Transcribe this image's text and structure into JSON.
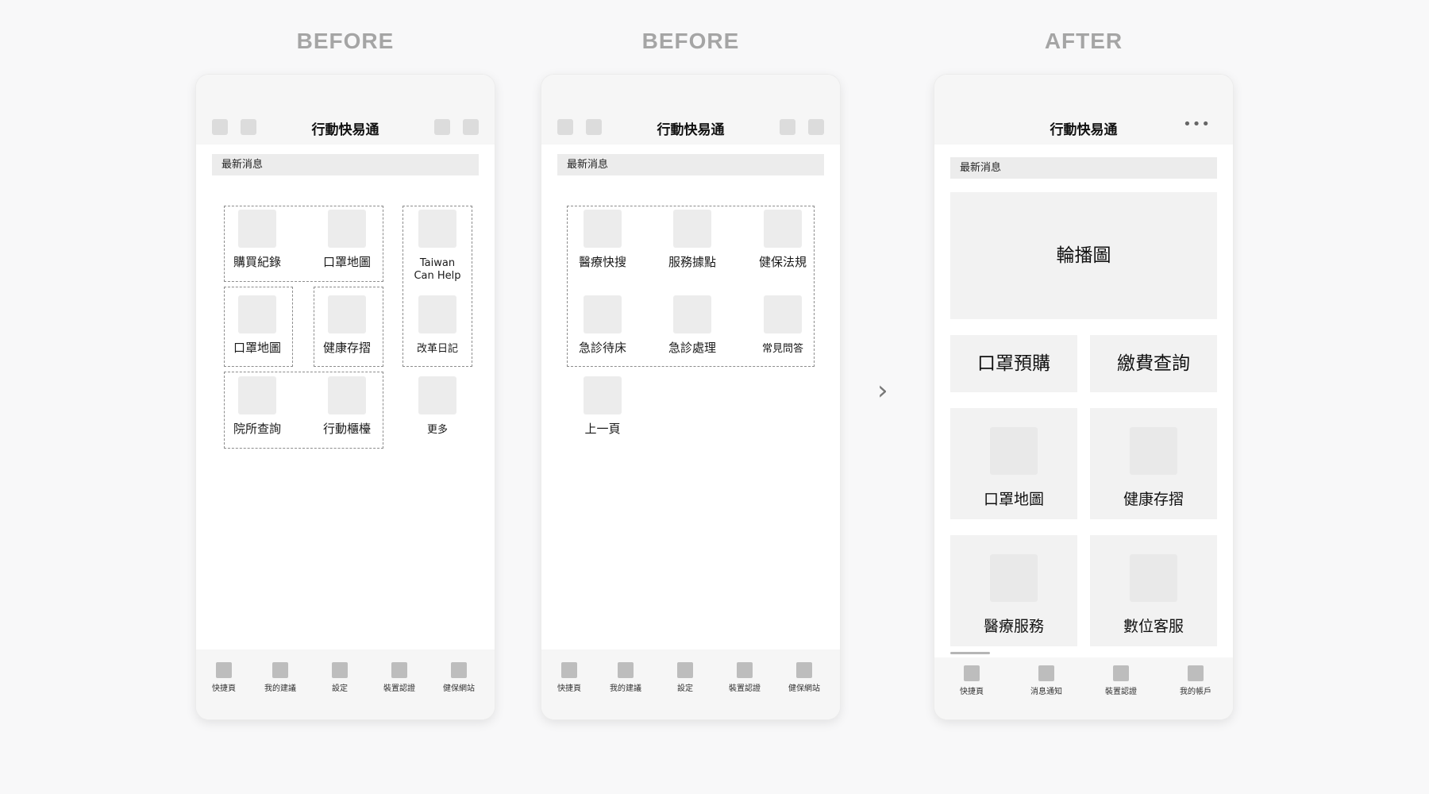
{
  "labels": {
    "before1": "BEFORE",
    "before2": "BEFORE",
    "after": "AFTER"
  },
  "app_title": "行動快易通",
  "news_label": "最新消息",
  "icons": {
    "more": "more-dots-icon",
    "arrow": "chevron-right-icon"
  },
  "more_dots": "•••",
  "arrow_glyph": "›",
  "before1": {
    "tiles": [
      "購買紀錄",
      "口罩地圖",
      "Taiwan Can Help",
      "口罩地圖",
      "健康存摺",
      "改革日記",
      "院所查詢",
      "行動櫃檯",
      "更多"
    ],
    "tabs": [
      "快捷頁",
      "我的建議",
      "設定",
      "裝置認證",
      "健保網站"
    ]
  },
  "before2": {
    "tiles": [
      "醫療快搜",
      "服務據點",
      "健保法規",
      "急診待床",
      "急診處理",
      "常見問答",
      "上一頁"
    ],
    "tabs": [
      "快捷頁",
      "我的建議",
      "設定",
      "裝置認證",
      "健保網站"
    ]
  },
  "after": {
    "carousel": "輪播圖",
    "buttons": [
      "口罩預購",
      "繳費查詢"
    ],
    "cards": [
      "口罩地圖",
      "健康存摺",
      "醫療服務",
      "數位客服"
    ],
    "tabs": [
      "快捷頁",
      "消息通知",
      "裝置認證",
      "我的帳戶"
    ]
  }
}
